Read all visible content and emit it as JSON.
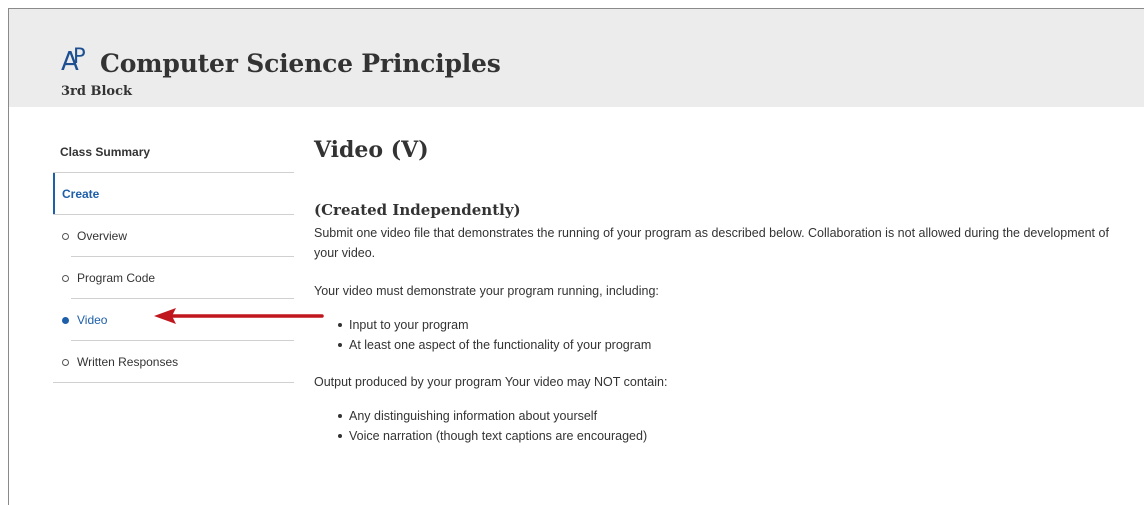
{
  "header": {
    "logo_letters": "AP",
    "app_title": "Computer Science Principles",
    "block": "3rd Block"
  },
  "sidebar": {
    "items": [
      {
        "label": "Class Summary"
      },
      {
        "label": "Create"
      },
      {
        "label": "Overview"
      },
      {
        "label": "Program Code"
      },
      {
        "label": "Video"
      },
      {
        "label": "Written Responses"
      }
    ]
  },
  "main": {
    "title": "Video (V)",
    "subheading": "(Created Independently)",
    "intro": "Submit one video file that demonstrates the running of your program as described below. Collaboration is not allowed during the development of your video.",
    "requirements_lead": "Your video must demonstrate your program running, including:",
    "requirements": [
      "Input to your program",
      "At least one aspect of the functionality of your program"
    ],
    "restrictions_lead": "Output produced by your program Your video may NOT contain:",
    "restrictions": [
      "Any distinguishing information about yourself",
      "Voice narration (though text captions are encouraged)"
    ]
  },
  "colors": {
    "accent": "#1d5fa8",
    "arrow": "#c0161d",
    "header_bg": "#ececec"
  },
  "annotation": {
    "icon": "arrow-left-icon",
    "points_to": "Video"
  }
}
